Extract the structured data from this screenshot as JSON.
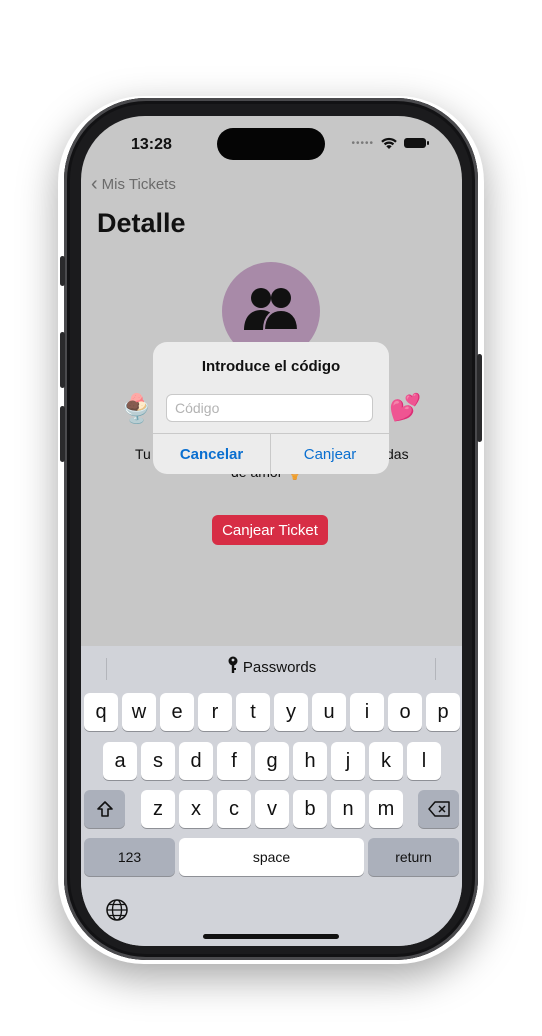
{
  "status_bar": {
    "time": "13:28"
  },
  "nav": {
    "back_label": "Mis Tickets",
    "title": "Detalle"
  },
  "ticket": {
    "emoji_left": "🍨",
    "emoji_right": "💕",
    "description_left": "Tu",
    "description_right": "das",
    "description_line2": "de amor 🍦",
    "redeem_button": "Canjear Ticket"
  },
  "alert": {
    "title": "Introduce el código",
    "input_placeholder": "Código",
    "input_value": "",
    "cancel_label": "Cancelar",
    "confirm_label": "Canjear"
  },
  "keyboard": {
    "passwords_label": "Passwords",
    "row1": [
      "q",
      "w",
      "e",
      "r",
      "t",
      "y",
      "u",
      "i",
      "o",
      "p"
    ],
    "row2": [
      "a",
      "s",
      "d",
      "f",
      "g",
      "h",
      "j",
      "k",
      "l"
    ],
    "row3": [
      "z",
      "x",
      "c",
      "v",
      "b",
      "n",
      "m"
    ],
    "numbers_key": "123",
    "space_key": "space",
    "return_key": "return"
  },
  "colors": {
    "accent_red": "#d72d45",
    "alert_button_blue": "#0a6fd0",
    "avatar_purple": "#a88aa8"
  }
}
